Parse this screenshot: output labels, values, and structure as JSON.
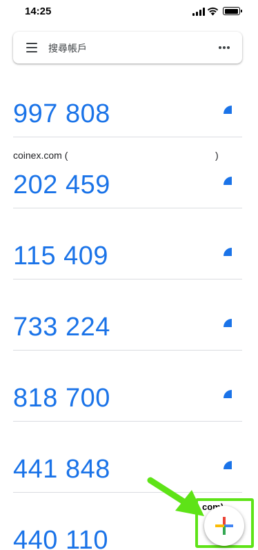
{
  "status_bar": {
    "time": "14:25"
  },
  "search_bar": {
    "placeholder": "搜尋帳戶"
  },
  "accounts": [
    {
      "code": "997 808"
    },
    {
      "code": "202 459",
      "label": "coinex.com (",
      "label_tail": ")"
    },
    {
      "code": "115 409"
    },
    {
      "code": "733 224"
    },
    {
      "code": "818 700"
    },
    {
      "code": "441 848"
    },
    {
      "code": "440 110",
      "label_partial": "com)"
    }
  ],
  "colors": {
    "code_blue": "#1a73e8",
    "highlight_green": "#5ee317",
    "google_red": "#ea4335",
    "google_blue": "#4285f4",
    "google_yellow": "#fbbc05",
    "google_green": "#34a853"
  },
  "icons": {
    "menu": "hamburger-menu-icon",
    "more": "more-horizontal-icon",
    "timer": "countdown-timer-icon",
    "add": "google-plus-icon"
  }
}
